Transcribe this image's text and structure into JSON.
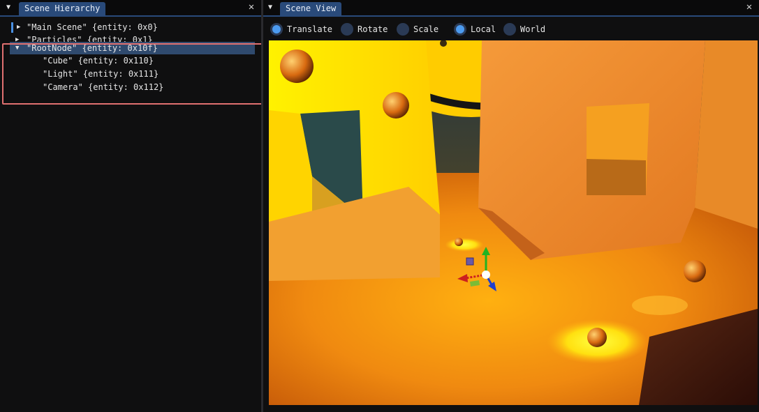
{
  "hierarchy": {
    "tab_label": "Scene Hierarchy",
    "close_glyph": "✕",
    "items": [
      {
        "label": "\"Main Scene\" {entity: 0x0}"
      },
      {
        "label": "\"Particles\" {entity: 0x1}"
      },
      {
        "label": "\"RootNode\" {entity: 0x10f}"
      },
      {
        "label": "\"Cube\" {entity: 0x110}"
      },
      {
        "label": "\"Light\" {entity: 0x111}"
      },
      {
        "label": "\"Camera\" {entity: 0x112}"
      }
    ],
    "selected_item": "\"RootNode\" {entity: 0x10f}"
  },
  "scene_view": {
    "tab_label": "Scene View",
    "close_glyph": "✕",
    "toolbar": {
      "operation_options": [
        {
          "label": "Translate",
          "selected": true
        },
        {
          "label": "Rotate",
          "selected": false
        },
        {
          "label": "Scale",
          "selected": false
        }
      ],
      "space_options": [
        {
          "label": "Local",
          "selected": true
        },
        {
          "label": "World",
          "selected": false
        }
      ]
    },
    "gizmo": {
      "x_axis_color": "#cc1f1f",
      "y_axis_color": "#22b322",
      "z_axis_color": "#1f3fcc"
    }
  },
  "theme": {
    "background": "#0f0f10",
    "tab_active": "#294a7a",
    "selection": "#2f4a6e",
    "highlight_frame": "#e07070",
    "accent": "#4c9bf0"
  }
}
